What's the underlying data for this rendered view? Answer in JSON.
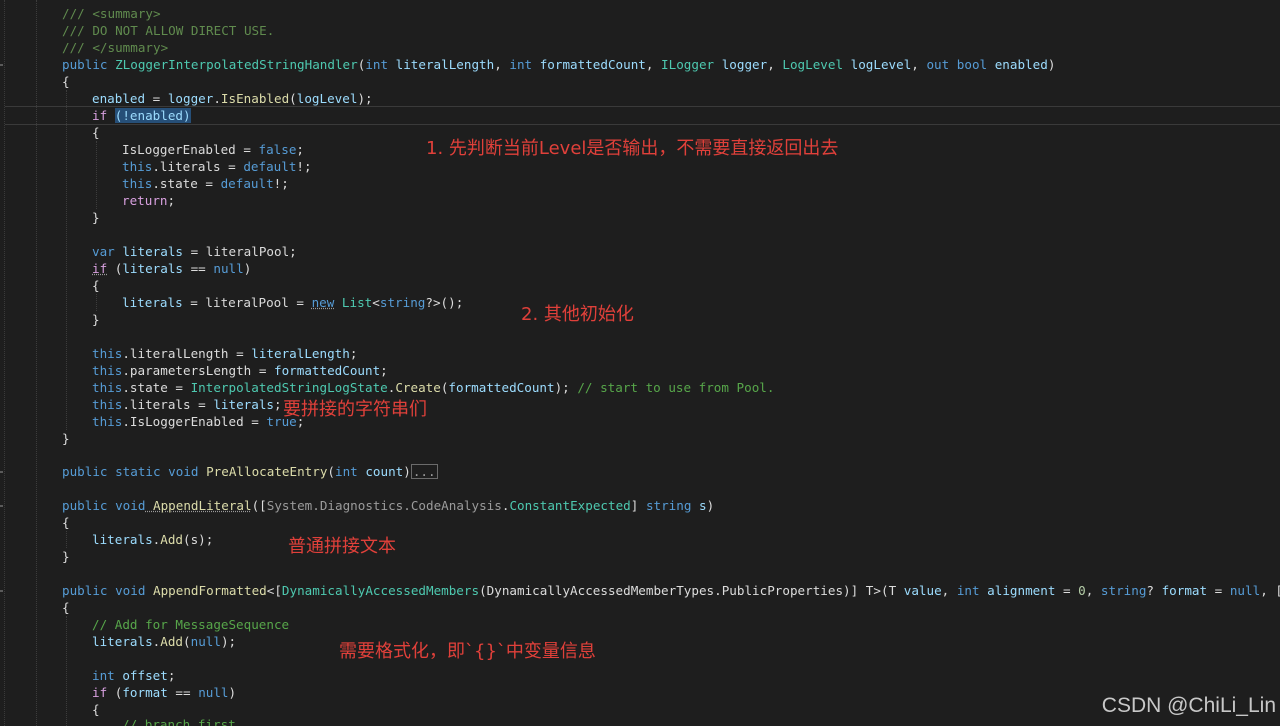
{
  "code": {
    "l1": "/// <summary>",
    "l2": "/// DO NOT ALLOW DIRECT USE.",
    "l3": "/// </summary>",
    "l4": {
      "a": "public ",
      "b": "ZLoggerInterpolatedStringHandler",
      "c": "(",
      "d": "int",
      "e": " literalLength",
      "f": ", ",
      "g": "int",
      "h": " formattedCount",
      "i": ", ",
      "j": "ILogger",
      "k": " logger",
      "l": ", ",
      "m": "LogLevel",
      "n": " logLevel",
      "o": ", ",
      "p": "out",
      "q": " bool",
      "r": " enabled",
      "s": ")"
    },
    "l5": "{",
    "l6": {
      "a": "enabled",
      "b": " = ",
      "c": "logger",
      "d": ".",
      "e": "IsEnabled",
      "f": "(",
      "g": "logLevel",
      "h": ");"
    },
    "l7": {
      "a": "if",
      "b": " ",
      "c": "(!enabled)"
    },
    "l8": "{",
    "l9": {
      "a": "IsLoggerEnabled",
      "b": " = ",
      "c": "false",
      "d": ";"
    },
    "l10": {
      "a": "this",
      "b": ".literals",
      "c": " = ",
      "d": "default",
      "e": "!;"
    },
    "l11": {
      "a": "this",
      "b": ".state",
      "c": " = ",
      "d": "default",
      "e": "!;"
    },
    "l12": {
      "a": "return",
      "b": ";"
    },
    "l13": "}",
    "l14": {
      "a": "var",
      "b": " literals",
      "c": " = ",
      "d": "literalPool",
      "e": ";"
    },
    "l15": {
      "a": "if",
      "b": " (",
      "c": "literals",
      "d": " == ",
      "e": "null",
      "f": ")"
    },
    "l16": "{",
    "l17": {
      "a": "literals",
      "b": " = ",
      "c": "literalPool",
      "d": " = ",
      "e": "new",
      "f": " ",
      "g": "List",
      "h": "<",
      "i": "string",
      "j": "?>();"
    },
    "l18": "}",
    "l19": {
      "a": "this",
      "b": ".literalLength",
      "c": " = ",
      "d": "literalLength",
      "e": ";"
    },
    "l20": {
      "a": "this",
      "b": ".parametersLength",
      "c": " = ",
      "d": "formattedCount",
      "e": ";"
    },
    "l21": {
      "a": "this",
      "b": ".state",
      "c": " = ",
      "d": "InterpolatedStringLogState",
      "e": ".",
      "f": "Create",
      "g": "(",
      "h": "formattedCount",
      "i": "); ",
      "j": "// start to use from Pool."
    },
    "l22": {
      "a": "this",
      "b": ".literals",
      "c": " = ",
      "d": "literals",
      "e": ";"
    },
    "l23": {
      "a": "this",
      "b": ".IsLoggerEnabled",
      "c": " = ",
      "d": "true",
      "e": ";"
    },
    "l24": "}",
    "l25": {
      "a": "public",
      "b": " static",
      "c": " void",
      "d": " PreAllocateEntry",
      "e": "(",
      "f": "int",
      "g": " count",
      "h": ")",
      "i": "..."
    },
    "l26": {
      "a": "public",
      "b": " void",
      "c": " AppendLiteral",
      "d": "([",
      "e": "System",
      "f": ".",
      "g": "Diagnostics",
      "h": ".",
      "i": "CodeAnalysis",
      "j": ".",
      "k": "ConstantExpected",
      "l": "] ",
      "m": "string",
      "n": " s",
      "o": ")"
    },
    "l27": "{",
    "l28": {
      "a": "literals",
      "b": ".",
      "c": "Add",
      "d": "(s);"
    },
    "l29": "}",
    "l30": {
      "a": "public",
      "b": " void",
      "c": " AppendFormatted",
      "d": "<[",
      "e": "DynamicallyAccessedMembers",
      "f": "(",
      "g": "DynamicallyAccessedMemberTypes",
      "h": ".",
      "i": "PublicProperties",
      "j": ")] ",
      "k": "T",
      "l": ">(",
      "m": "T",
      "n": " value",
      "o": ", ",
      "p": "int",
      "q": " alignment",
      "r": " = ",
      "s": "0",
      "t": ", ",
      "u": "string",
      "v": "?",
      "w": " format",
      "x": " = ",
      "y": "null",
      "z": ", [Ca"
    },
    "l31": "{",
    "l32": "// Add for MessageSequence",
    "l33": {
      "a": "literals",
      "b": ".",
      "c": "Add",
      "d": "(",
      "e": "null",
      "f": ");"
    },
    "l34": {
      "a": "int",
      "b": " offset",
      "c": ";"
    },
    "l35": {
      "a": "if",
      "b": " (",
      "c": "format",
      "d": " == ",
      "e": "null",
      "f": ")"
    },
    "l36": "{",
    "l37": "// branch first"
  },
  "annotations": {
    "note1": "1. 先判断当前Level是否输出，不需要直接返回出去",
    "note2": "2. 其他初始化",
    "note3": "要拼接的字符串们",
    "note4": "普通拼接文本",
    "note5": "需要格式化，即`{}`中变量信息"
  },
  "watermark": "CSDN @ChiLi_Lin",
  "colors": {
    "background": "#1e1e1e",
    "keyword": "#569cd6",
    "control": "#d8a0df",
    "type": "#4ec9b0",
    "method": "#dcdcaa",
    "parameter": "#9cdcfe",
    "comment": "#57a64a",
    "annotation": "#e0403a"
  }
}
